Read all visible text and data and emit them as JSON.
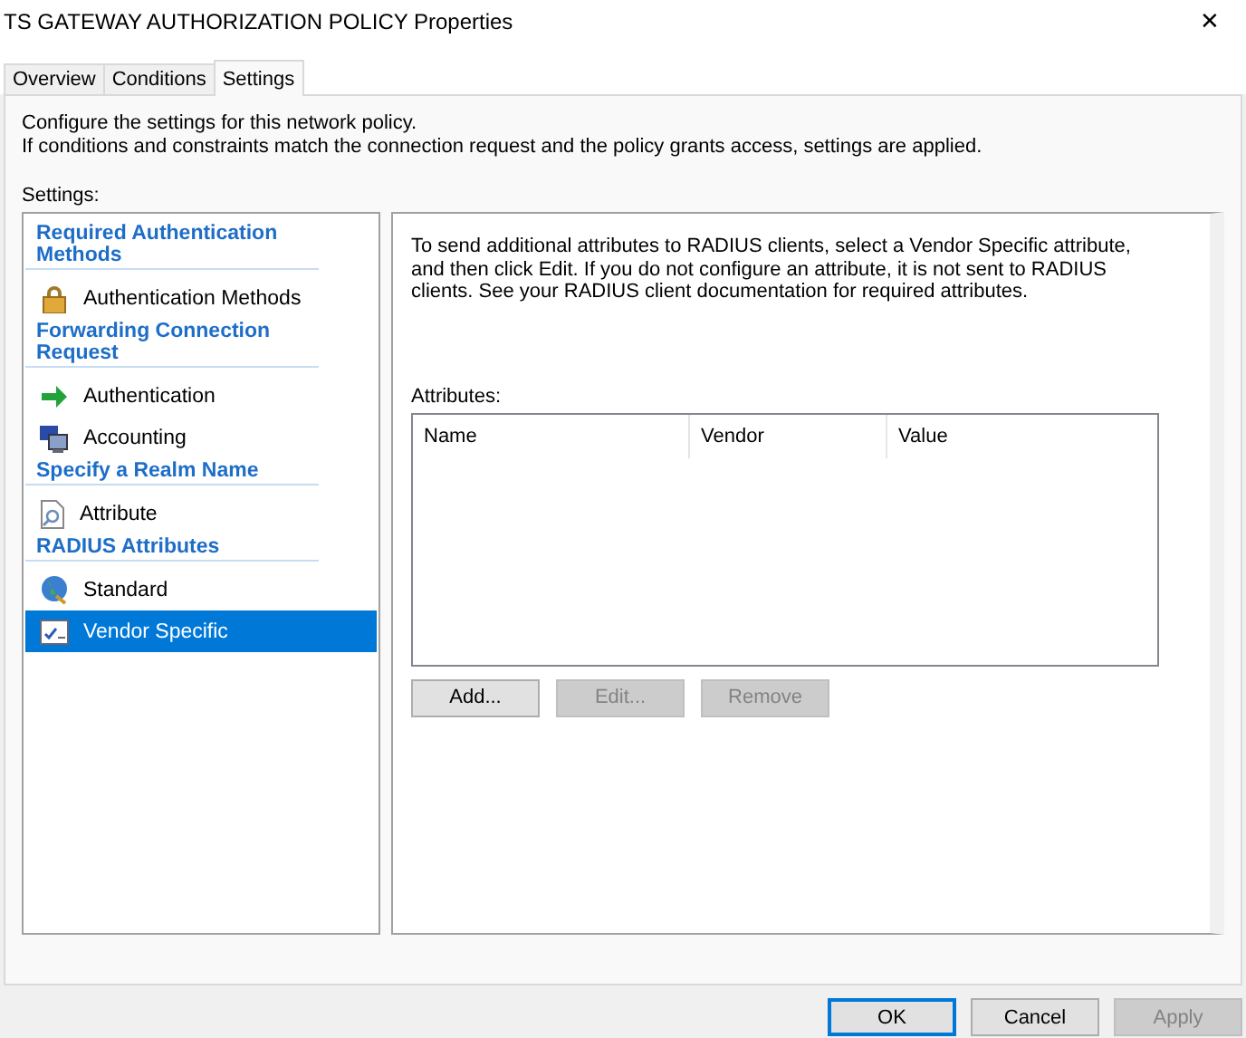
{
  "window": {
    "title": "TS GATEWAY AUTHORIZATION POLICY Properties",
    "close": "✕"
  },
  "tabs": [
    {
      "label": "Overview",
      "selected": false
    },
    {
      "label": "Conditions",
      "selected": false
    },
    {
      "label": "Settings",
      "selected": true
    }
  ],
  "intro": [
    "Configure the settings for this network policy.",
    "If conditions and constraints match the connection request and the policy grants access, settings are applied."
  ],
  "settings_label": "Settings:",
  "sidebar": {
    "items": [
      {
        "kind": "header",
        "label": "Required Authentication Methods"
      },
      {
        "kind": "item",
        "label": "Authentication Methods",
        "selected": false
      },
      {
        "kind": "header",
        "label": "Forwarding Connection Request"
      },
      {
        "kind": "item",
        "label": "Authentication",
        "selected": false
      },
      {
        "kind": "item",
        "label": "Accounting",
        "selected": false
      },
      {
        "kind": "header",
        "label": "Specify a Realm Name"
      },
      {
        "kind": "item",
        "label": "Attribute",
        "selected": false
      },
      {
        "kind": "header",
        "label": "RADIUS Attributes"
      },
      {
        "kind": "item",
        "label": "Standard",
        "selected": false
      },
      {
        "kind": "item",
        "label": "Vendor Specific",
        "selected": true
      }
    ]
  },
  "detail": {
    "description": "To send additional attributes to RADIUS clients, select a Vendor Specific attribute, and then click Edit. If you do not configure an attribute, it is not sent to RADIUS clients. See your RADIUS client documentation for required attributes.",
    "list_label": "Attributes:",
    "table": {
      "columns": [
        "Name",
        "Vendor",
        "Value"
      ]
    },
    "buttons": [
      {
        "label": "Add...",
        "disabled": false
      },
      {
        "label": "Edit...",
        "disabled": true
      },
      {
        "label": "Remove",
        "disabled": true
      }
    ]
  },
  "footer_buttons": [
    {
      "label": "OK",
      "disabled": false,
      "default": true
    },
    {
      "label": "Cancel",
      "disabled": false,
      "default": false
    },
    {
      "label": "Apply",
      "disabled": true,
      "default": false
    }
  ]
}
